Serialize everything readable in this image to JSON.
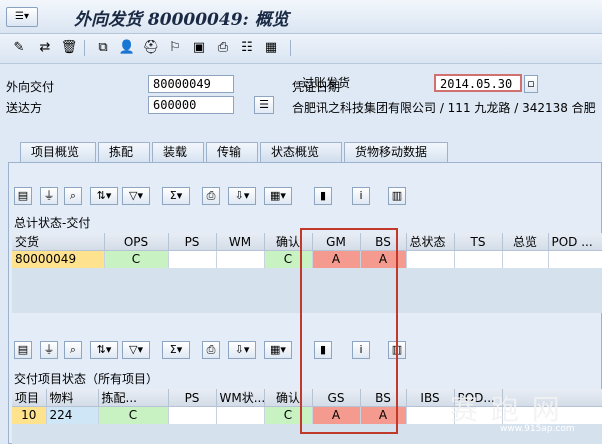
{
  "window": {
    "title": "外向发货 80000049: 概览",
    "menu_icon": "menu-icon"
  },
  "toolbar": {
    "post_label": "过账发货"
  },
  "header": {
    "delivery_label": "外向交付",
    "delivery_value": "80000049",
    "shipto_label": "送达方",
    "shipto_value": "600000",
    "docdate_label": "凭证日期",
    "docdate_value": "2014.05.30",
    "address": "合肥讯之科技集团有限公司 / 111 九龙路 / 342138 合肥"
  },
  "tabs": [
    {
      "label": "项目概览"
    },
    {
      "label": "拣配"
    },
    {
      "label": "装载"
    },
    {
      "label": "传输"
    },
    {
      "label": "状态概览",
      "active": true
    },
    {
      "label": "货物移动数据"
    }
  ],
  "overall": {
    "title": "总计状态-交付",
    "headers": [
      "交货",
      "OPS",
      "PS",
      "WM",
      "确认",
      "GM",
      "BS",
      "总状态",
      "TS",
      "总览",
      "POD ..."
    ],
    "row": [
      "80000049",
      "C",
      "",
      "",
      "C",
      "A",
      "A",
      "",
      "",
      "",
      ""
    ]
  },
  "items": {
    "title": "交付项目状态（所有项目）",
    "headers": [
      "项目",
      "物料",
      "拣配...",
      "PS",
      "WM状...",
      "确认",
      "GS",
      "BS",
      "IBS",
      "POD..."
    ],
    "row": [
      "10",
      "224",
      "C",
      "",
      "",
      "C",
      "A",
      "A",
      "",
      ""
    ]
  },
  "watermark": {
    "text": "赛 跑 网",
    "sub": "www.915ap.com"
  },
  "colors": {
    "highlight_box": "#c0392b",
    "status_green": "#c9f2c2",
    "status_red": "#f59a8e",
    "key_yellow": "#ffe28e"
  }
}
